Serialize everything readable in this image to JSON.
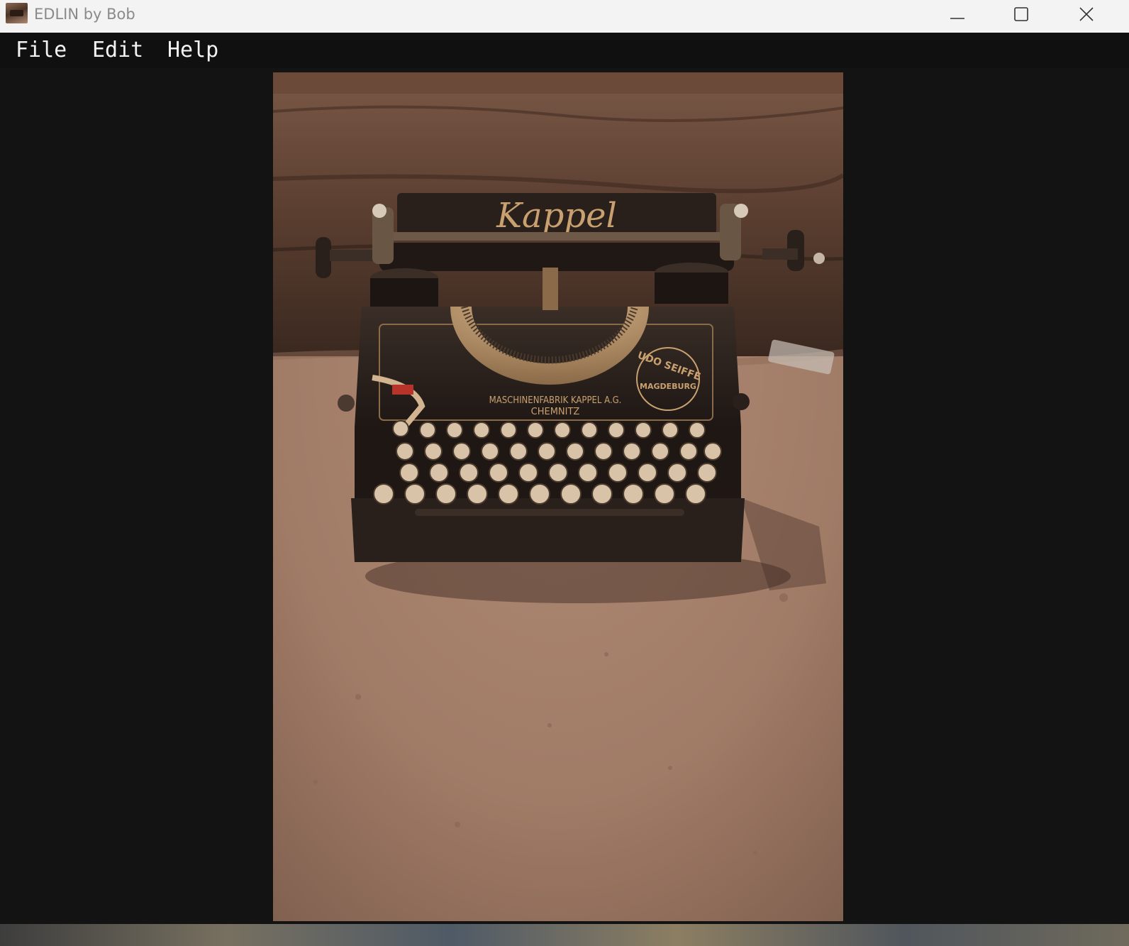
{
  "window": {
    "title": "EDLIN by Bob",
    "app_icon": "typewriter-app-icon",
    "controls": {
      "minimize": "minimize-icon",
      "maximize": "maximize-icon",
      "close": "close-icon"
    }
  },
  "menu": {
    "items": [
      "File",
      "Edit",
      "Help"
    ]
  },
  "image": {
    "subject": "vintage typewriter on sandy ground",
    "brand_lettering": "Kappel",
    "plate_line_1": "MASCHINENFABRIK KAPPEL A.G.",
    "plate_line_2": "CHEMNITZ",
    "badge_top": "UDO SEIFFE",
    "badge_middle": "MAGDEBURG",
    "colors": {
      "sand": "#a8806a",
      "wall": "#5e4232",
      "machine": "#2a201b",
      "brass": "#c7a070"
    }
  }
}
